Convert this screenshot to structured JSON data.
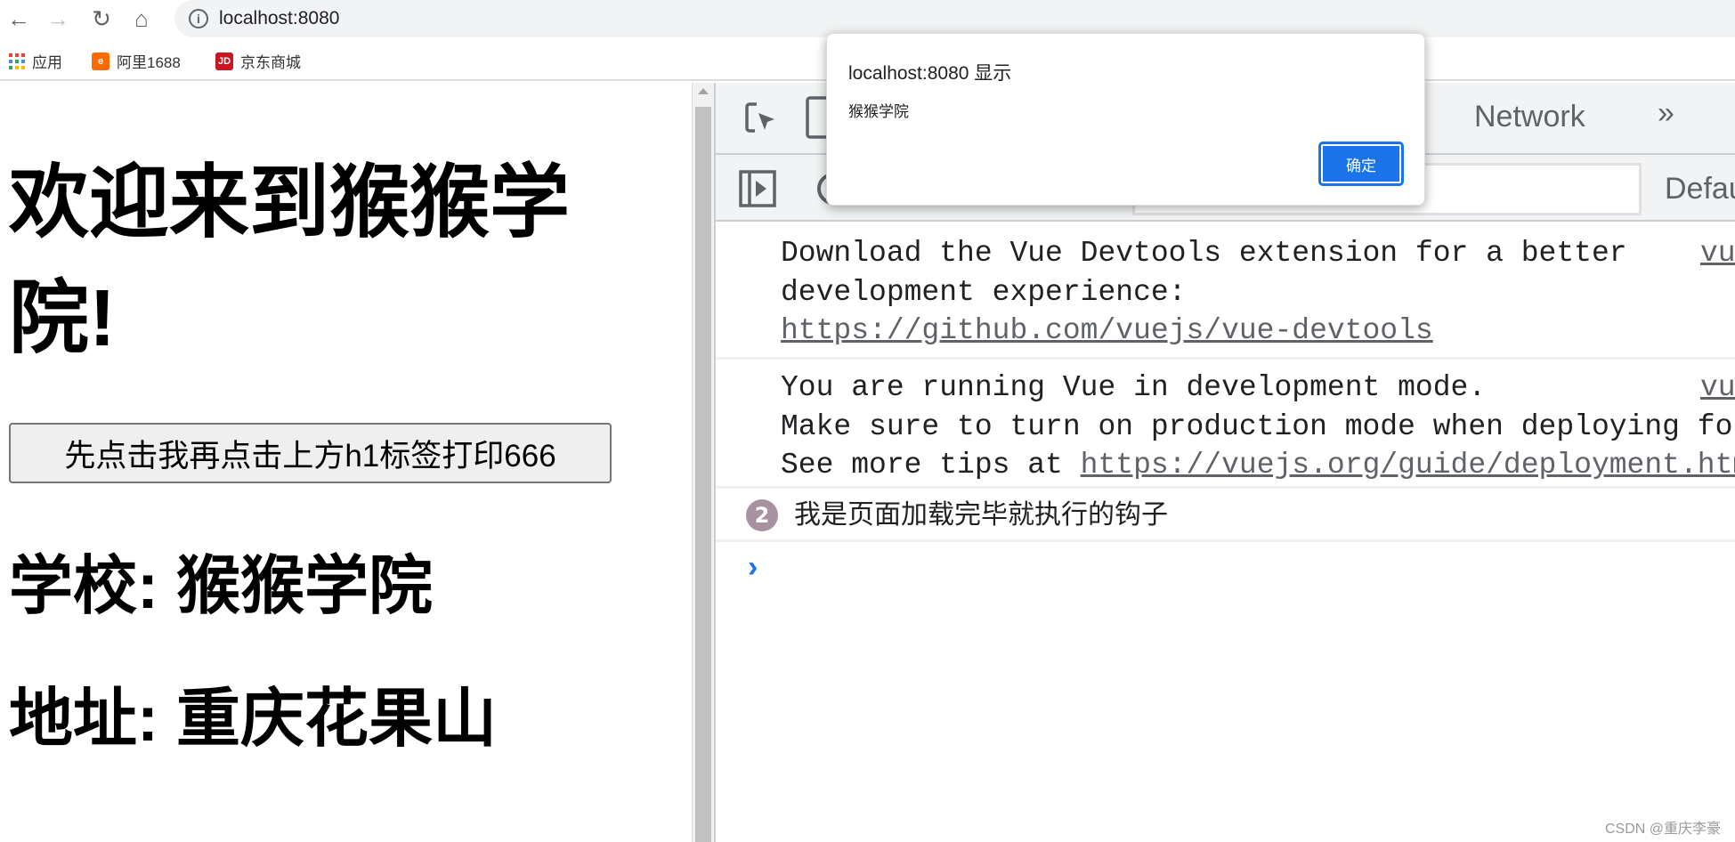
{
  "browser": {
    "url": "localhost:8080",
    "back_icon": "arrow-left",
    "forward_icon": "arrow-right",
    "reload_icon": "reload",
    "home_icon": "home"
  },
  "bookmarks": [
    {
      "label": "应用",
      "icon": "apps-grid"
    },
    {
      "label": "阿里1688",
      "icon": "alibaba-logo"
    },
    {
      "label": "京东商城",
      "icon": "jd-logo"
    }
  ],
  "page": {
    "h1": "欢迎来到猴猴学院!",
    "button": "先点击我再点击上方h1标签打印666",
    "school": "学校: 猴猴学院",
    "address": "地址: 重庆花果山"
  },
  "devtools": {
    "tabs": {
      "network": "Network",
      "more": "»"
    },
    "levels": "Defau",
    "logs": [
      {
        "lines": [
          "Download the Vue Devtools extension for a better",
          "development experience:"
        ],
        "link": "https://github.com/vuejs/vue-devtools",
        "source": "vue"
      },
      {
        "lines": [
          "You are running Vue in development mode.",
          "Make sure to turn on production mode when deploying for"
        ],
        "prefix": "See more tips at ",
        "link": "https://vuejs.org/guide/deployment.html",
        "source": "vue"
      },
      {
        "count": "2",
        "message": "我是页面加载完毕就执行的钩子"
      }
    ]
  },
  "dialog": {
    "title": "localhost:8080 显示",
    "message": "猴猴学院",
    "ok": "确定",
    "accent": "#1a73e8"
  },
  "watermark": "CSDN @重庆李豪"
}
